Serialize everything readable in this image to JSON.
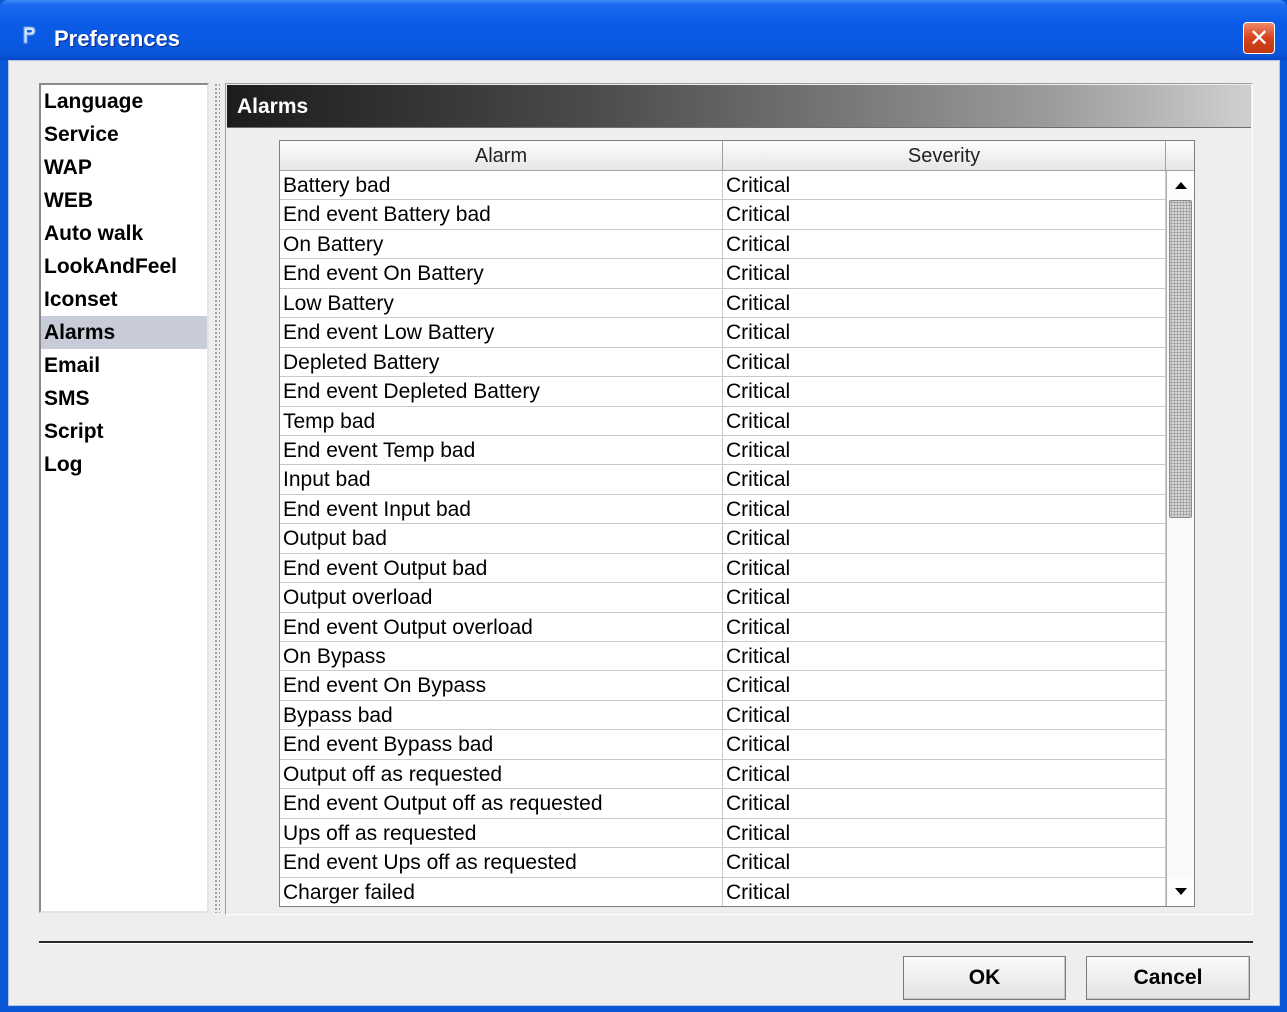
{
  "window": {
    "title": "Preferences",
    "close_label": "✕"
  },
  "sidebar": {
    "items": [
      {
        "label": "Language"
      },
      {
        "label": "Service"
      },
      {
        "label": "WAP"
      },
      {
        "label": "WEB"
      },
      {
        "label": "Auto walk"
      },
      {
        "label": "LookAndFeel"
      },
      {
        "label": "Iconset"
      },
      {
        "label": "Alarms"
      },
      {
        "label": "Email"
      },
      {
        "label": "SMS"
      },
      {
        "label": "Script"
      },
      {
        "label": "Log"
      }
    ],
    "selected": "Alarms"
  },
  "panel": {
    "title": "Alarms"
  },
  "table": {
    "columns": [
      "Alarm",
      "Severity"
    ],
    "rows": [
      [
        "Battery bad",
        "Critical"
      ],
      [
        "End event Battery bad",
        "Critical"
      ],
      [
        "On Battery",
        "Critical"
      ],
      [
        "End event On Battery",
        "Critical"
      ],
      [
        "Low Battery",
        "Critical"
      ],
      [
        "End event Low Battery",
        "Critical"
      ],
      [
        "Depleted Battery",
        "Critical"
      ],
      [
        "End event Depleted Battery",
        "Critical"
      ],
      [
        "Temp bad",
        "Critical"
      ],
      [
        "End event Temp bad",
        "Critical"
      ],
      [
        "Input bad",
        "Critical"
      ],
      [
        "End event Input bad",
        "Critical"
      ],
      [
        "Output bad",
        "Critical"
      ],
      [
        "End event Output bad",
        "Critical"
      ],
      [
        "Output overload",
        "Critical"
      ],
      [
        "End event Output overload",
        "Critical"
      ],
      [
        "On Bypass",
        "Critical"
      ],
      [
        "End event On Bypass",
        "Critical"
      ],
      [
        "Bypass bad",
        "Critical"
      ],
      [
        "End event Bypass bad",
        "Critical"
      ],
      [
        "Output off as requested",
        "Critical"
      ],
      [
        "End event Output off as requested",
        "Critical"
      ],
      [
        "Ups off as requested",
        "Critical"
      ],
      [
        "End event Ups off as requested",
        "Critical"
      ],
      [
        "Charger failed",
        "Critical"
      ]
    ]
  },
  "buttons": {
    "ok": "OK",
    "cancel": "Cancel"
  },
  "colors": {
    "title_bar": "#0a5ae6",
    "selection": "#c8cbd8",
    "close_button": "#d5431c"
  },
  "icons": {
    "app": "app-logo-icon",
    "close": "close-icon",
    "scroll_up": "arrow-up-icon",
    "scroll_down": "arrow-down-icon"
  }
}
